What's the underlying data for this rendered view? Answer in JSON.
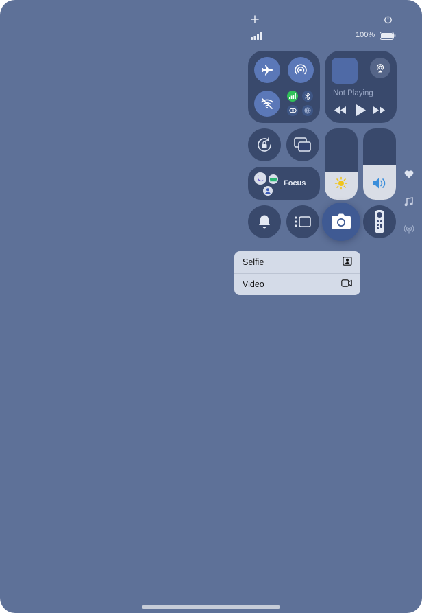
{
  "status_bar": {
    "add_icon": "plus-icon",
    "power_icon": "power-icon",
    "battery_text": "100%"
  },
  "connectivity": {
    "airplane_icon": "airplane-icon",
    "airdrop_icon": "airdrop-icon",
    "wifi_icon": "wifi-off-icon",
    "cellular_icon": "cellular-icon",
    "bluetooth_icon": "bluetooth-icon",
    "hotspot_icon": "hotspot-icon",
    "vpn_icon": "vpn-icon",
    "cellular_color": "#31c15a"
  },
  "media": {
    "status": "Not Playing",
    "airplay_icon": "airplay-icon"
  },
  "focus": {
    "label": "Focus"
  },
  "sliders": {
    "brightness": {
      "level": 0.39
    },
    "volume": {
      "level": 0.49
    }
  },
  "side_icons": [
    "heart-icon",
    "music-note-icon",
    "broadcast-icon"
  ],
  "camera_menu": {
    "items": [
      {
        "label": "Selfie",
        "icon": "selfie-portrait-icon"
      },
      {
        "label": "Video",
        "icon": "video-camera-icon"
      }
    ]
  },
  "colors": {
    "background": "#5e7198",
    "tile": "#233050",
    "accent_blue": "#5b78b8",
    "menu_bg": "#d4dbe8"
  }
}
